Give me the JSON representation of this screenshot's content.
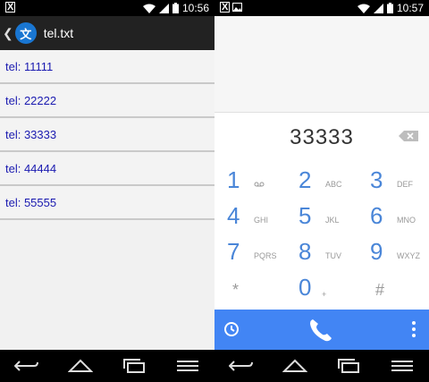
{
  "left": {
    "status": {
      "time": "10:56"
    },
    "app": {
      "title": "tel.txt",
      "icon_char": "文"
    },
    "rows": [
      "tel: 11111",
      "tel: 22222",
      "tel: 33333",
      "tel: 44444",
      "tel: 55555"
    ]
  },
  "right": {
    "status": {
      "time": "10:57"
    },
    "dialer": {
      "number": "33333",
      "keys": [
        {
          "digit": "1",
          "letters": "ᴏᴏ"
        },
        {
          "digit": "2",
          "letters": "ABC"
        },
        {
          "digit": "3",
          "letters": "DEF"
        },
        {
          "digit": "4",
          "letters": "GHI"
        },
        {
          "digit": "5",
          "letters": "JKL"
        },
        {
          "digit": "6",
          "letters": "MNO"
        },
        {
          "digit": "7",
          "letters": "PQRS"
        },
        {
          "digit": "8",
          "letters": "TUV"
        },
        {
          "digit": "9",
          "letters": "WXYZ"
        },
        {
          "digit": "*",
          "letters": ""
        },
        {
          "digit": "0",
          "letters": "+"
        },
        {
          "digit": "#",
          "letters": ""
        }
      ]
    }
  },
  "icons": {
    "status_notification": "x-box-icon",
    "wifi": "wifi-icon",
    "signal": "signal-icon",
    "battery": "battery-icon",
    "back": "back-icon",
    "home": "home-icon",
    "recents": "recents-icon",
    "menu": "menu-icon",
    "call": "phone-icon",
    "history": "clock-icon",
    "overflow": "overflow-icon",
    "backspace": "backspace-icon"
  },
  "colors": {
    "accent": "#4285f4",
    "digit": "#4a86d8",
    "link": "#1a1ab0"
  }
}
